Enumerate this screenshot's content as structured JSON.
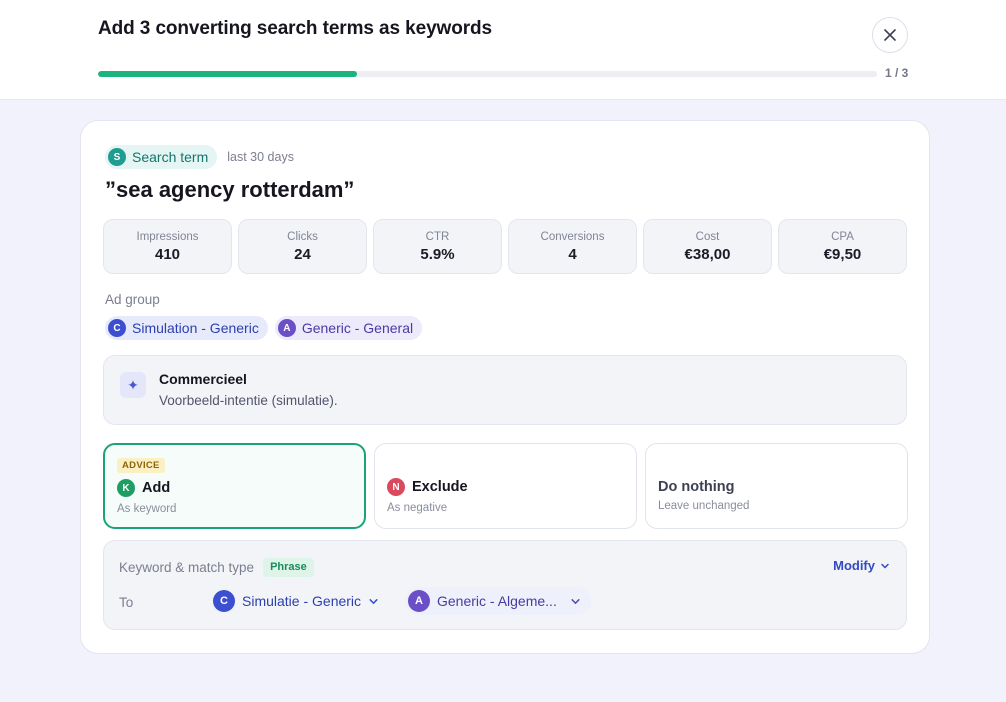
{
  "header": {
    "title": "Add 3 converting search terms as keywords",
    "progress_label": "1 / 3",
    "progress_fraction": 0.333
  },
  "term": {
    "type_label": "Search term",
    "type_initial": "S",
    "period": "last 30 days",
    "title": "”sea agency rotterdam”"
  },
  "metrics": [
    {
      "label": "Impressions",
      "value": "410"
    },
    {
      "label": "Clicks",
      "value": "24"
    },
    {
      "label": "CTR",
      "value": "5.9%"
    },
    {
      "label": "Conversions",
      "value": "4"
    },
    {
      "label": "Cost",
      "value": "€38,00"
    },
    {
      "label": "CPA",
      "value": "€9,50"
    }
  ],
  "ad_group": {
    "label": "Ad group",
    "chips": [
      {
        "initial": "C",
        "label": "Simulation - Generic"
      },
      {
        "initial": "A",
        "label": "Generic - General"
      }
    ]
  },
  "intent": {
    "icon": "sparkle-icon",
    "title": "Commercieel",
    "subtitle": "Voorbeeld-intentie (simulatie)."
  },
  "options": {
    "add": {
      "badge": "ADVICE",
      "initial": "K",
      "title": "Add",
      "subtitle": "As keyword"
    },
    "exclude": {
      "initial": "N",
      "title": "Exclude",
      "subtitle": "As negative"
    },
    "nothing": {
      "title": "Do nothing",
      "subtitle": "Leave unchanged"
    }
  },
  "keyword": {
    "label": "Keyword & match type",
    "match_type": "Phrase",
    "modify_label": "Modify",
    "to_label": "To",
    "campaign": {
      "initial": "C",
      "label": "Simulatie - Generic"
    },
    "ad_group": {
      "initial": "A",
      "label": "Generic - Algeme..."
    }
  },
  "colors": {
    "accent_green": "#1db37c",
    "accent_blue": "#3449c2",
    "advice_badge_bg": "#fbefc4"
  }
}
